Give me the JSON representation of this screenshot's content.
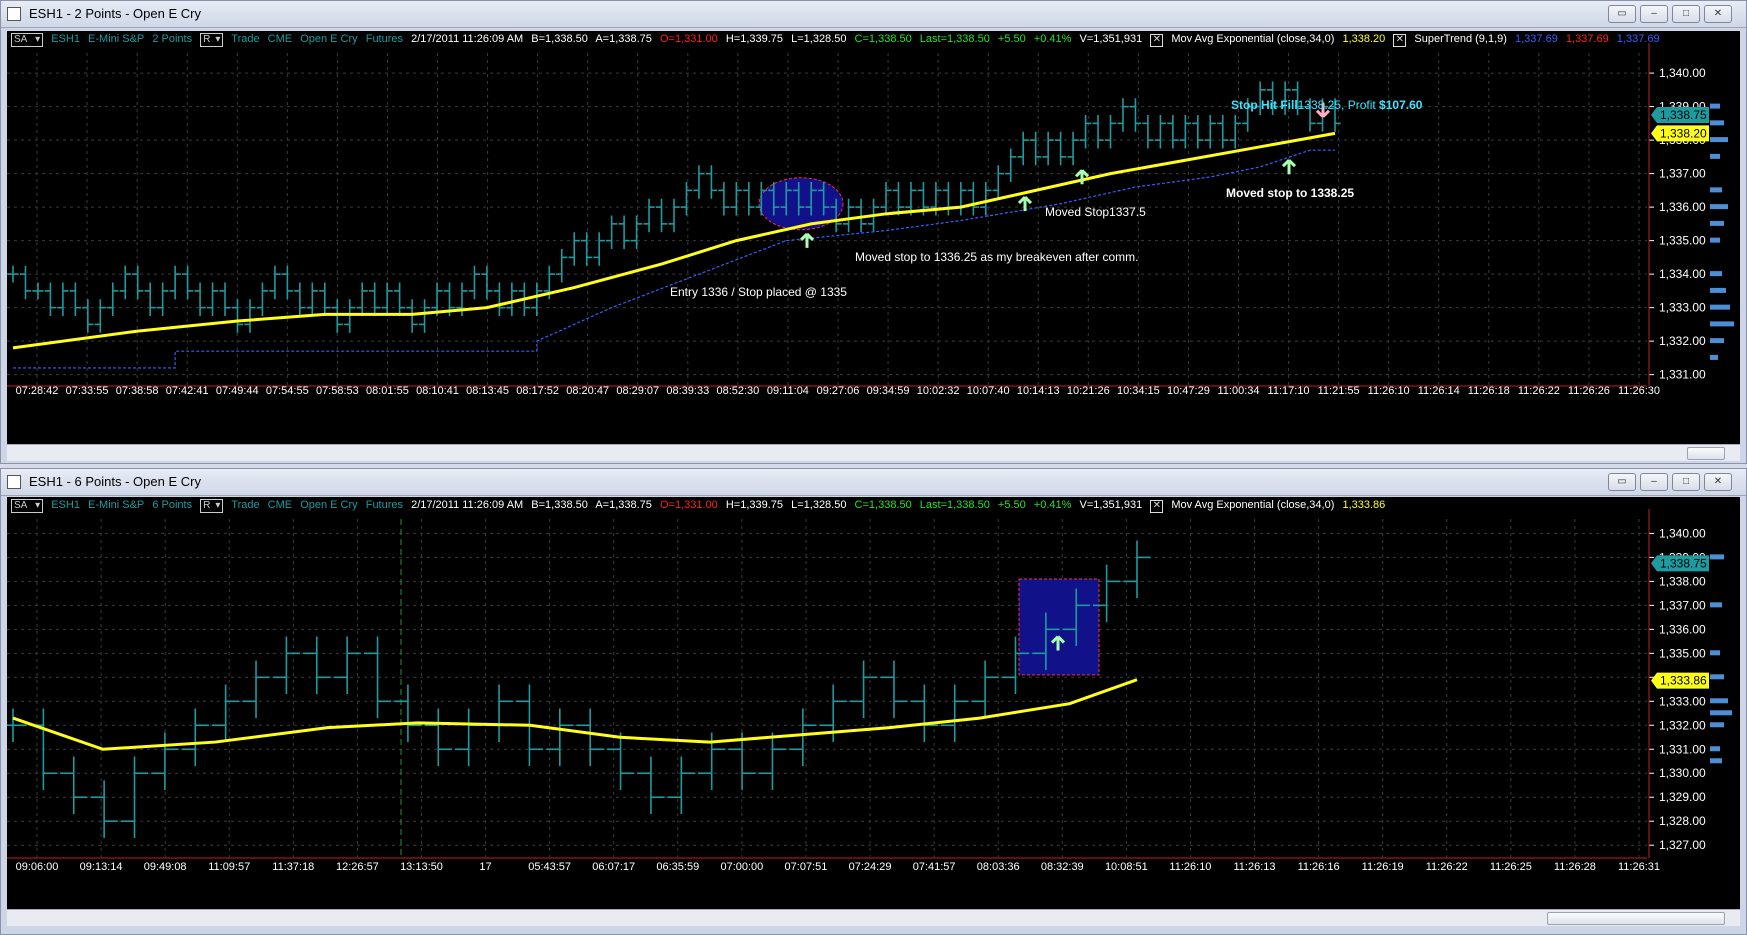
{
  "top": {
    "window_title": "ESH1 - 2 Points - Open E Cry",
    "header": {
      "sa": "SA",
      "symbol": "ESH1",
      "instrument": "E-Mini S&P",
      "interval": "2 Points",
      "r": "R",
      "trade": "Trade",
      "exchange": "CME",
      "broker": "Open E Cry",
      "futures": "Futures",
      "datetime": "2/17/2011  11:26:09 AM",
      "bid": "B=1,338.50",
      "ask": "A=1,338.75",
      "open": "O=1,331.00",
      "high": "H=1,339.75",
      "low": "L=1,328.50",
      "close": "C=1,338.50",
      "last": "Last=1,338.50",
      "change": "+5.50",
      "pct": "+0.41%",
      "volume": "V=1,351,931",
      "ind1_name": "Mov Avg Exponential  (close,34,0)",
      "ind1_value": "1,338.20",
      "ind2_name": "SuperTrend  (9,1,9)",
      "ind2_v1": "1,337.69",
      "ind2_v2": "1,337.69",
      "ind2_v3": "1,337.69"
    },
    "price_tag_last": "1,338.75",
    "price_tag_ma": "1,338.20",
    "annotations": {
      "entry": "Entry 1336 / Stop placed @ 1335",
      "breakeven": "Moved stop to 1336.25 as my breakeven after comm.",
      "moved1": "Moved Stop1337.5",
      "moved2": "Moved stop to 1338.25",
      "stophit_a": "Stop Hit Fill",
      "stophit_b": "1338.25, Profit ",
      "stophit_c": "$107.60"
    }
  },
  "bottom": {
    "window_title": "ESH1 - 6 Points - Open E Cry",
    "header": {
      "sa": "SA",
      "symbol": "ESH1",
      "instrument": "E-Mini S&P",
      "interval": "6 Points",
      "r": "R",
      "trade": "Trade",
      "exchange": "CME",
      "broker": "Open E Cry",
      "futures": "Futures",
      "datetime": "2/17/2011  11:26:09 AM",
      "bid": "B=1,338.50",
      "ask": "A=1,338.75",
      "open": "O=1,331.00",
      "high": "H=1,339.75",
      "low": "L=1,328.50",
      "close": "C=1,338.50",
      "last": "Last=1,338.50",
      "change": "+5.50",
      "pct": "+0.41%",
      "volume": "V=1,351,931",
      "ind1_name": "Mov Avg Exponential  (close,34,0)",
      "ind1_value": "1,333.86"
    },
    "price_tag_last": "1,338.75",
    "price_tag_ma": "1,333.86"
  },
  "colors": {
    "bars": "#1d9ba0",
    "ma": "#ffff1a",
    "supertrend": "#3c5cff",
    "grid": "#3a3a3a",
    "axis_text": "#ffffff",
    "highlight_fill": "#11118a",
    "highlight_border": "#ff2a4a",
    "arrow_up": "#a8ffb0",
    "arrow_down": "#ffb0c0",
    "annotation_cyan": "#3fe4ff"
  },
  "chart_data": [
    {
      "type": "ohlc",
      "name": "ESH1 2 Points",
      "ylim": [
        1330.9,
        1340.6
      ],
      "yticks": [
        "1,340.00",
        "1,339.00",
        "1,338.00",
        "1,337.00",
        "1,336.00",
        "1,335.00",
        "1,334.00",
        "1,333.00",
        "1,332.00",
        "1,331.00"
      ],
      "time_labels": [
        "07:28:42",
        "07:33:55",
        "07:38:58",
        "07:42:41",
        "07:49:44",
        "07:54:55",
        "07:58:53",
        "08:01:55",
        "08:10:41",
        "08:13:45",
        "08:17:52",
        "08:20:47",
        "08:29:07",
        "08:39:33",
        "08:52:30",
        "09:11:04",
        "09:27:06",
        "09:34:59",
        "10:02:32",
        "10:07:40",
        "10:14:13",
        "10:21:26",
        "10:34:15",
        "10:47:29",
        "11:00:34",
        "11:17:10",
        "11:21:55",
        "11:26:10",
        "11:26:14",
        "11:26:18",
        "11:26:22",
        "11:26:26",
        "11:26:30"
      ],
      "closes": [
        1334,
        1333.5,
        1333.5,
        1333,
        1333.5,
        1333,
        1332.5,
        1333,
        1333.5,
        1334,
        1333.5,
        1333,
        1333.5,
        1334,
        1333.5,
        1333,
        1333.5,
        1333,
        1332.5,
        1333,
        1333.5,
        1334,
        1333.5,
        1333,
        1333.5,
        1333,
        1332.5,
        1333,
        1333.5,
        1333,
        1333.5,
        1333,
        1332.5,
        1333,
        1333.5,
        1333,
        1333.5,
        1334,
        1333.5,
        1333,
        1333.5,
        1333,
        1333.5,
        1334,
        1334.5,
        1335,
        1334.5,
        1335,
        1335.5,
        1335,
        1335.5,
        1336,
        1335.5,
        1336,
        1336.5,
        1337,
        1336.5,
        1336,
        1336.5,
        1336,
        1336.5,
        1336,
        1336.5,
        1336,
        1336.5,
        1336,
        1335.5,
        1336,
        1335.5,
        1336,
        1336.5,
        1336,
        1336.5,
        1336,
        1336.5,
        1336,
        1336.5,
        1336,
        1336.5,
        1337,
        1337.5,
        1338,
        1337.5,
        1338,
        1337.5,
        1338,
        1338.5,
        1338,
        1338.5,
        1339,
        1338.5,
        1338,
        1338.5,
        1338,
        1338.5,
        1338,
        1338.5,
        1338,
        1338.5,
        1339,
        1339.5,
        1339,
        1339.5,
        1339,
        1338.5,
        1339,
        1338.5
      ],
      "series": [
        {
          "name": "Mov Avg Exponential (close,34,0)",
          "points": [
            [
              0,
              1331.8
            ],
            [
              10,
              1332.3
            ],
            [
              18,
              1332.6
            ],
            [
              25,
              1332.8
            ],
            [
              32,
              1332.8
            ],
            [
              38,
              1333.0
            ],
            [
              45,
              1333.6
            ],
            [
              52,
              1334.3
            ],
            [
              58,
              1335.0
            ],
            [
              64,
              1335.5
            ],
            [
              70,
              1335.8
            ],
            [
              76,
              1336.0
            ],
            [
              82,
              1336.5
            ],
            [
              88,
              1337.0
            ],
            [
              94,
              1337.4
            ],
            [
              100,
              1337.8
            ],
            [
              106,
              1338.2
            ]
          ]
        },
        {
          "name": "SuperTrend (9,1,9)",
          "points": [
            [
              0,
              1331.2
            ],
            [
              13,
              1331.2
            ],
            [
              13,
              1331.7
            ],
            [
              42,
              1331.7
            ],
            [
              42,
              1332.0
            ],
            [
              48,
              1333.0
            ],
            [
              55,
              1334.0
            ],
            [
              62,
              1335.0
            ],
            [
              70,
              1335.3
            ],
            [
              76,
              1335.6
            ],
            [
              84,
              1336.1
            ],
            [
              90,
              1336.6
            ],
            [
              96,
              1336.9
            ],
            [
              100,
              1337.2
            ],
            [
              104,
              1337.7
            ],
            [
              106,
              1337.7
            ]
          ]
        }
      ],
      "annotations": {
        "entry_price": 1336,
        "stop_price": 1335,
        "breakeven_stop": 1336.25,
        "moved_stop_1": 1337.5,
        "moved_stop_2": 1338.25,
        "fill_price": 1338.25,
        "profit": 107.6
      }
    },
    {
      "type": "ohlc",
      "name": "ESH1 6 Points",
      "ylim": [
        1326.8,
        1340.6
      ],
      "yticks": [
        "1,340.00",
        "1,339.00",
        "1,338.00",
        "1,337.00",
        "1,336.00",
        "1,335.00",
        "1,334.00",
        "1,333.00",
        "1,332.00",
        "1,331.00",
        "1,330.00",
        "1,329.00",
        "1,328.00",
        "1,327.00"
      ],
      "time_labels": [
        "09:06:00",
        "09:13:14",
        "09:49:08",
        "11:09:57",
        "11:37:18",
        "12:26:57",
        "13:13:50",
        "17",
        "05:43:57",
        "06:07:17",
        "06:35:59",
        "07:00:00",
        "07:07:51",
        "07:24:29",
        "07:41:57",
        "08:03:36",
        "08:32:39",
        "10:08:51",
        "11:26:10",
        "11:26:13",
        "11:26:16",
        "11:26:19",
        "11:26:22",
        "11:26:25",
        "11:26:28",
        "11:26:31"
      ],
      "closes": [
        1332,
        1330,
        1329,
        1328,
        1330,
        1331,
        1332,
        1333,
        1334,
        1335,
        1334,
        1335,
        1333,
        1332,
        1331,
        1332,
        1333,
        1331,
        1332,
        1331,
        1330,
        1329,
        1330,
        1331,
        1330,
        1331,
        1332,
        1333,
        1334,
        1333,
        1332,
        1333,
        1334,
        1335,
        1336,
        1337,
        1338,
        1339
      ],
      "series": [
        {
          "name": "Mov Avg Exponential (close,34,0)",
          "points": [
            [
              0,
              1332.3
            ],
            [
              4,
              1331.0
            ],
            [
              9,
              1331.3
            ],
            [
              14,
              1331.9
            ],
            [
              18,
              1332.1
            ],
            [
              23,
              1332.0
            ],
            [
              27,
              1331.5
            ],
            [
              31,
              1331.3
            ],
            [
              35,
              1331.6
            ],
            [
              39,
              1331.9
            ],
            [
              43,
              1332.3
            ],
            [
              47,
              1332.9
            ],
            [
              50,
              1333.9
            ]
          ]
        }
      ]
    }
  ]
}
